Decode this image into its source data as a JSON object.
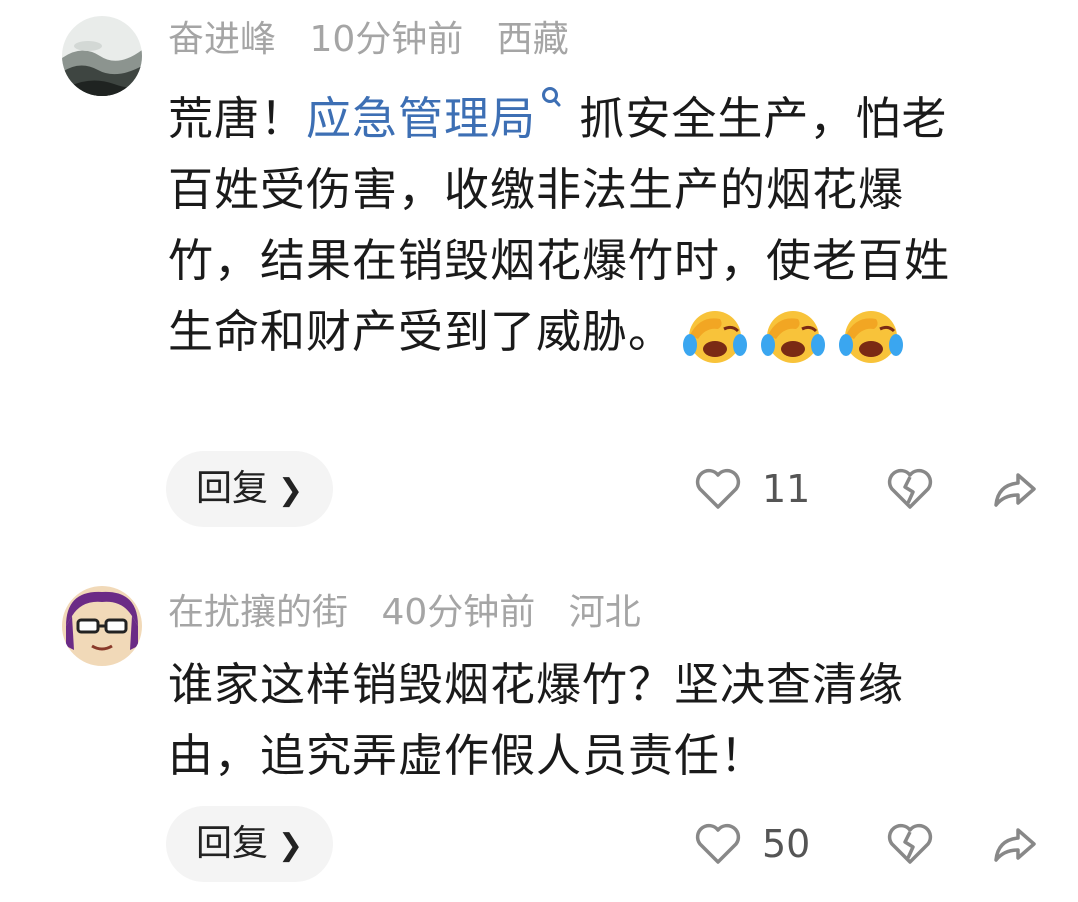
{
  "comments": [
    {
      "username": "奋进峰",
      "time": "10分钟前",
      "location": "西藏",
      "text_before": "荒唐！",
      "link_text": "应急管理局",
      "text_after": " 抓安全生产，怕老百姓受伤害，收缴非法生产的烟花爆竹，结果在销毁烟花爆竹时，使老百姓生命和财产受到了威胁。",
      "reply_label": "回复",
      "likes": "11",
      "avatar_icon": "landscape-avatar-icon",
      "emoji_icon": "facepalm-laugh-emoji"
    },
    {
      "username": "在扰攘的街",
      "time": "40分钟前",
      "location": "河北",
      "text": "谁家这样销毁烟花爆竹？坚决查清缘由，追究弄虚作假人员责任！",
      "reply_label": "回复",
      "likes": "50",
      "avatar_icon": "cartoon-glasses-avatar-icon"
    }
  ],
  "colors": {
    "meta": "#a5a5a5",
    "link": "#3d6fb4",
    "text": "#1a1a1a",
    "reply_bg": "#f4f4f4",
    "icon": "#888888"
  },
  "icons": [
    "heart-icon",
    "broken-heart-icon",
    "share-icon",
    "chevron-right-icon",
    "search-icon"
  ]
}
